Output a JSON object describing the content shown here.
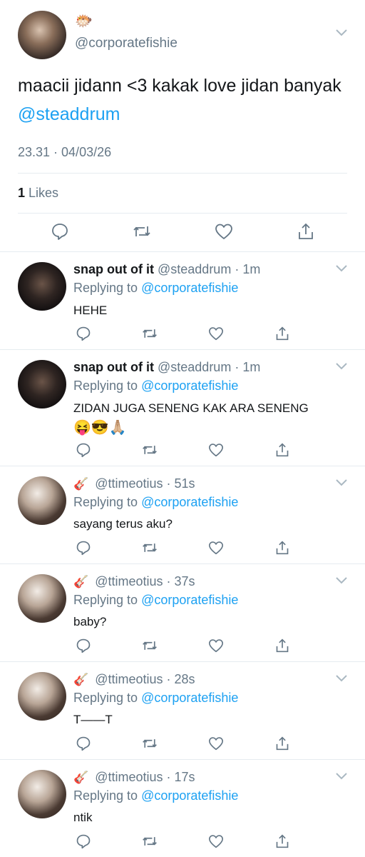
{
  "main_tweet": {
    "emoji": "🐡",
    "handle": "@corporatefishie",
    "text": "maacii jidann <3 kakak love jidan banyak ",
    "mention": "@steaddrum",
    "timestamp": "23.31 · 04/03/26",
    "likes_count": "1",
    "likes_label": " Likes"
  },
  "icons": {
    "reply": "reply-icon",
    "retweet": "retweet-icon",
    "like": "heart-icon",
    "share": "share-icon",
    "menu": "chevron-down-icon"
  },
  "replies": [
    {
      "name": "snap out of it",
      "handle": "@steaddrum",
      "time": "1m",
      "replying_prefix": "Replying to ",
      "replying_to": "@corporatefishie",
      "text": "HEHE",
      "text2": ""
    },
    {
      "name": "snap out of it",
      "handle": "@steaddrum",
      "time": "1m",
      "replying_prefix": "Replying to ",
      "replying_to": "@corporatefishie",
      "text": "ZIDAN JUGA SENENG KAK ARA SENENG",
      "text2": "😝😎🙏🏼"
    },
    {
      "name": "🎸",
      "handle": "@ttimeotius",
      "time": "51s",
      "replying_prefix": "Replying to ",
      "replying_to": "@corporatefishie",
      "text": "sayang terus aku?",
      "text2": ""
    },
    {
      "name": "🎸",
      "handle": "@ttimeotius",
      "time": "37s",
      "replying_prefix": "Replying to ",
      "replying_to": "@corporatefishie",
      "text": "baby?",
      "text2": ""
    },
    {
      "name": "🎸",
      "handle": "@ttimeotius",
      "time": "28s",
      "replying_prefix": "Replying to ",
      "replying_to": "@corporatefishie",
      "text": "T——T",
      "text2": ""
    },
    {
      "name": "🎸",
      "handle": "@ttimeotius",
      "time": "17s",
      "replying_prefix": "Replying to ",
      "replying_to": "@corporatefishie",
      "text": "ntik",
      "text2": ""
    }
  ]
}
